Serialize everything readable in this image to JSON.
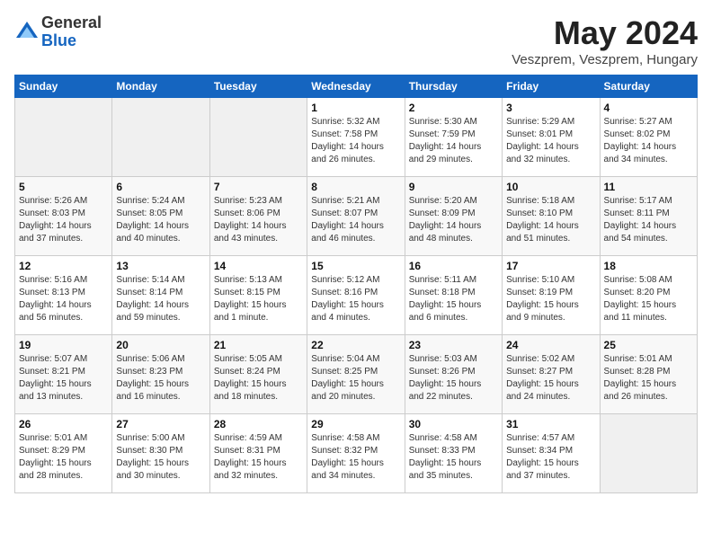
{
  "logo": {
    "general": "General",
    "blue": "Blue"
  },
  "title": "May 2024",
  "location": "Veszprem, Veszprem, Hungary",
  "days_of_week": [
    "Sunday",
    "Monday",
    "Tuesday",
    "Wednesday",
    "Thursday",
    "Friday",
    "Saturday"
  ],
  "weeks": [
    [
      {
        "num": "",
        "sunrise": "",
        "sunset": "",
        "daylight": "",
        "empty": true
      },
      {
        "num": "",
        "sunrise": "",
        "sunset": "",
        "daylight": "",
        "empty": true
      },
      {
        "num": "",
        "sunrise": "",
        "sunset": "",
        "daylight": "",
        "empty": true
      },
      {
        "num": "1",
        "sunrise": "Sunrise: 5:32 AM",
        "sunset": "Sunset: 7:58 PM",
        "daylight": "Daylight: 14 hours and 26 minutes."
      },
      {
        "num": "2",
        "sunrise": "Sunrise: 5:30 AM",
        "sunset": "Sunset: 7:59 PM",
        "daylight": "Daylight: 14 hours and 29 minutes."
      },
      {
        "num": "3",
        "sunrise": "Sunrise: 5:29 AM",
        "sunset": "Sunset: 8:01 PM",
        "daylight": "Daylight: 14 hours and 32 minutes."
      },
      {
        "num": "4",
        "sunrise": "Sunrise: 5:27 AM",
        "sunset": "Sunset: 8:02 PM",
        "daylight": "Daylight: 14 hours and 34 minutes."
      }
    ],
    [
      {
        "num": "5",
        "sunrise": "Sunrise: 5:26 AM",
        "sunset": "Sunset: 8:03 PM",
        "daylight": "Daylight: 14 hours and 37 minutes."
      },
      {
        "num": "6",
        "sunrise": "Sunrise: 5:24 AM",
        "sunset": "Sunset: 8:05 PM",
        "daylight": "Daylight: 14 hours and 40 minutes."
      },
      {
        "num": "7",
        "sunrise": "Sunrise: 5:23 AM",
        "sunset": "Sunset: 8:06 PM",
        "daylight": "Daylight: 14 hours and 43 minutes."
      },
      {
        "num": "8",
        "sunrise": "Sunrise: 5:21 AM",
        "sunset": "Sunset: 8:07 PM",
        "daylight": "Daylight: 14 hours and 46 minutes."
      },
      {
        "num": "9",
        "sunrise": "Sunrise: 5:20 AM",
        "sunset": "Sunset: 8:09 PM",
        "daylight": "Daylight: 14 hours and 48 minutes."
      },
      {
        "num": "10",
        "sunrise": "Sunrise: 5:18 AM",
        "sunset": "Sunset: 8:10 PM",
        "daylight": "Daylight: 14 hours and 51 minutes."
      },
      {
        "num": "11",
        "sunrise": "Sunrise: 5:17 AM",
        "sunset": "Sunset: 8:11 PM",
        "daylight": "Daylight: 14 hours and 54 minutes."
      }
    ],
    [
      {
        "num": "12",
        "sunrise": "Sunrise: 5:16 AM",
        "sunset": "Sunset: 8:13 PM",
        "daylight": "Daylight: 14 hours and 56 minutes."
      },
      {
        "num": "13",
        "sunrise": "Sunrise: 5:14 AM",
        "sunset": "Sunset: 8:14 PM",
        "daylight": "Daylight: 14 hours and 59 minutes."
      },
      {
        "num": "14",
        "sunrise": "Sunrise: 5:13 AM",
        "sunset": "Sunset: 8:15 PM",
        "daylight": "Daylight: 15 hours and 1 minute."
      },
      {
        "num": "15",
        "sunrise": "Sunrise: 5:12 AM",
        "sunset": "Sunset: 8:16 PM",
        "daylight": "Daylight: 15 hours and 4 minutes."
      },
      {
        "num": "16",
        "sunrise": "Sunrise: 5:11 AM",
        "sunset": "Sunset: 8:18 PM",
        "daylight": "Daylight: 15 hours and 6 minutes."
      },
      {
        "num": "17",
        "sunrise": "Sunrise: 5:10 AM",
        "sunset": "Sunset: 8:19 PM",
        "daylight": "Daylight: 15 hours and 9 minutes."
      },
      {
        "num": "18",
        "sunrise": "Sunrise: 5:08 AM",
        "sunset": "Sunset: 8:20 PM",
        "daylight": "Daylight: 15 hours and 11 minutes."
      }
    ],
    [
      {
        "num": "19",
        "sunrise": "Sunrise: 5:07 AM",
        "sunset": "Sunset: 8:21 PM",
        "daylight": "Daylight: 15 hours and 13 minutes."
      },
      {
        "num": "20",
        "sunrise": "Sunrise: 5:06 AM",
        "sunset": "Sunset: 8:23 PM",
        "daylight": "Daylight: 15 hours and 16 minutes."
      },
      {
        "num": "21",
        "sunrise": "Sunrise: 5:05 AM",
        "sunset": "Sunset: 8:24 PM",
        "daylight": "Daylight: 15 hours and 18 minutes."
      },
      {
        "num": "22",
        "sunrise": "Sunrise: 5:04 AM",
        "sunset": "Sunset: 8:25 PM",
        "daylight": "Daylight: 15 hours and 20 minutes."
      },
      {
        "num": "23",
        "sunrise": "Sunrise: 5:03 AM",
        "sunset": "Sunset: 8:26 PM",
        "daylight": "Daylight: 15 hours and 22 minutes."
      },
      {
        "num": "24",
        "sunrise": "Sunrise: 5:02 AM",
        "sunset": "Sunset: 8:27 PM",
        "daylight": "Daylight: 15 hours and 24 minutes."
      },
      {
        "num": "25",
        "sunrise": "Sunrise: 5:01 AM",
        "sunset": "Sunset: 8:28 PM",
        "daylight": "Daylight: 15 hours and 26 minutes."
      }
    ],
    [
      {
        "num": "26",
        "sunrise": "Sunrise: 5:01 AM",
        "sunset": "Sunset: 8:29 PM",
        "daylight": "Daylight: 15 hours and 28 minutes."
      },
      {
        "num": "27",
        "sunrise": "Sunrise: 5:00 AM",
        "sunset": "Sunset: 8:30 PM",
        "daylight": "Daylight: 15 hours and 30 minutes."
      },
      {
        "num": "28",
        "sunrise": "Sunrise: 4:59 AM",
        "sunset": "Sunset: 8:31 PM",
        "daylight": "Daylight: 15 hours and 32 minutes."
      },
      {
        "num": "29",
        "sunrise": "Sunrise: 4:58 AM",
        "sunset": "Sunset: 8:32 PM",
        "daylight": "Daylight: 15 hours and 34 minutes."
      },
      {
        "num": "30",
        "sunrise": "Sunrise: 4:58 AM",
        "sunset": "Sunset: 8:33 PM",
        "daylight": "Daylight: 15 hours and 35 minutes."
      },
      {
        "num": "31",
        "sunrise": "Sunrise: 4:57 AM",
        "sunset": "Sunset: 8:34 PM",
        "daylight": "Daylight: 15 hours and 37 minutes."
      },
      {
        "num": "",
        "sunrise": "",
        "sunset": "",
        "daylight": "",
        "empty": true
      }
    ]
  ]
}
